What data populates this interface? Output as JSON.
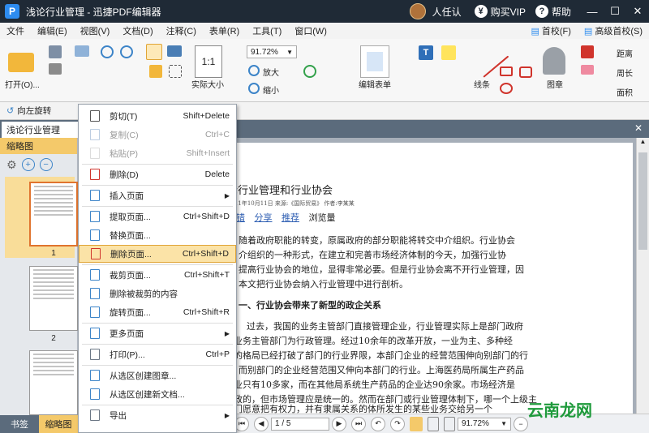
{
  "app": {
    "title": "浅论行业管理 - 迅捷PDF编辑器",
    "user_name": "人任认",
    "vip_label": "购买VIP",
    "help_label": "帮助",
    "logo_letter": "P"
  },
  "menubar": {
    "items": [
      "文件",
      "编辑(E)",
      "视图(V)",
      "文档(D)",
      "注释(C)",
      "表单(R)",
      "工具(T)",
      "窗口(W)"
    ],
    "right": [
      "首校(F)",
      "高级首校(S)"
    ]
  },
  "toolbar": {
    "open_label": "打开(O)...",
    "zoom_value": "91.72%",
    "zoom_in_label": "放大",
    "zoom_out_label": "缩小",
    "actual_size_label": "实际大小",
    "edit_form_label": "编辑表单",
    "lines_label": "线条",
    "stamp_label": "图章",
    "distance_label": "距离",
    "perimeter_label": "周长",
    "area_label": "面积"
  },
  "subbar": {
    "rotate_label": "向左旋转"
  },
  "tab": {
    "name": "浅论行业管理"
  },
  "left_panel": {
    "header": "缩略图",
    "pages": [
      "1",
      "2"
    ],
    "bottom_tabs": [
      "书签",
      "缩略图"
    ]
  },
  "context_menu": {
    "items": [
      {
        "label": "剪切(T)",
        "shortcut": "Shift+Delete",
        "icon": "scissors-icon",
        "state": "normal"
      },
      {
        "label": "复制(C)",
        "shortcut": "Ctrl+C",
        "icon": "copy-icon",
        "state": "disabled"
      },
      {
        "label": "粘贴(P)",
        "shortcut": "Shift+Insert",
        "icon": "paste-icon",
        "state": "disabled"
      },
      {
        "label": "删除(D)",
        "shortcut": "Delete",
        "icon": "trash-icon",
        "state": "normal"
      },
      {
        "label": "插入页面",
        "shortcut": "",
        "icon": "insert-page-icon",
        "state": "submenu"
      },
      {
        "label": "提取页面...",
        "shortcut": "Ctrl+Shift+D",
        "icon": "extract-page-icon",
        "state": "normal"
      },
      {
        "label": "替换页面...",
        "shortcut": "",
        "icon": "replace-page-icon",
        "state": "normal"
      },
      {
        "label": "删除页面...",
        "shortcut": "Ctrl+Shift+D",
        "icon": "delete-page-icon",
        "state": "highlighted"
      },
      {
        "label": "裁剪页面...",
        "shortcut": "Ctrl+Shift+T",
        "icon": "crop-page-icon",
        "state": "normal"
      },
      {
        "label": "删除被裁剪的内容",
        "shortcut": "",
        "icon": "remove-cropped-icon",
        "state": "normal"
      },
      {
        "label": "旋转页面...",
        "shortcut": "Ctrl+Shift+R",
        "icon": "rotate-page-icon",
        "state": "normal"
      },
      {
        "label": "更多页面",
        "shortcut": "",
        "icon": "more-pages-icon",
        "state": "submenu"
      },
      {
        "label": "打印(P)...",
        "shortcut": "Ctrl+P",
        "icon": "print-icon",
        "state": "normal"
      },
      {
        "label": "从选区创建图章...",
        "shortcut": "",
        "icon": "stamp-from-selection-icon",
        "state": "normal"
      },
      {
        "label": "从选区创建新文档...",
        "shortcut": "",
        "icon": "new-doc-from-selection-icon",
        "state": "normal"
      },
      {
        "label": "导出",
        "shortcut": "",
        "icon": "export-icon",
        "state": "submenu"
      }
    ]
  },
  "document": {
    "heading": "论行业管理和行业协会",
    "meta_line": "2011年10月11日 来源:《国际贸易》 作者:李某某",
    "tags": [
      "纠错",
      "分享",
      "推荐"
    ],
    "tags_suffix": "浏览量",
    "paragraph1": [
      "随着政府职能的转变，原属政府的部分职能将转交中介组织。行业协会",
      "介组织的一种形式，在建立和完善市场经济体制的今天，加强行业协",
      "提高行业协会的地位，显得非常必要。但是行业协会离不开行业管理，因",
      "本文把行业协会纳入行业管理中进行剖析。"
    ],
    "section_title": "一、行业协会带来了新型的政企关系",
    "paragraph2": [
      "过去，我国的业务主管部门直接管理企业，行业管理实际上是部门政府",
      "业务主管部门为行政管理。经过10余年的改革开放，一业为主、多种经",
      "的格局已经打破了部门的行业界限，本部门企业的经营范围伸向别部门的行",
      "而别部门的企业经营范围又伸向本部门的行业。上海医药局所属生产药品",
      "业只有10多家，而在其他局系统生产药品的企业达90余家。市场经济是",
      "政的，但市场管理应是统一的。然而在部门或行业管理体制下，哪一个上级主",
      "门愿意把有权力，并有隶属关系的体所发生的某些业务交给另一个"
    ]
  },
  "statusbar": {
    "page_field": "1 / 5",
    "zoom_field": "91.72%"
  },
  "watermark": "云南龙网"
}
